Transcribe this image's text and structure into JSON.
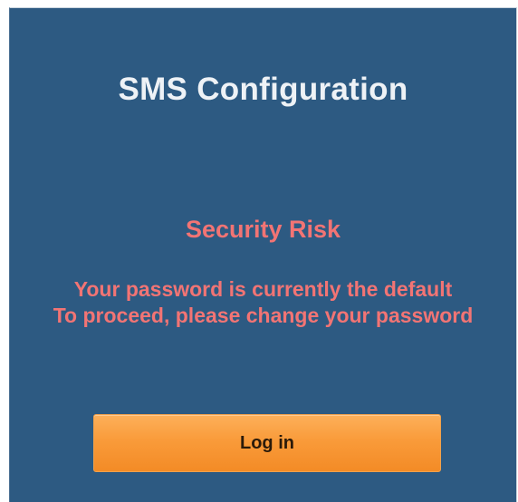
{
  "dialog": {
    "title": "SMS Configuration",
    "warning_heading": "Security Risk",
    "warning_lines": [
      "Your password is currently the default",
      "To proceed, please change your password"
    ],
    "login_button_label": "Log in"
  },
  "colors": {
    "panel_background": "#2d5a82",
    "title_text": "#eef2f6",
    "warning_text": "#f27474",
    "button_orange": "#f99b3a"
  }
}
